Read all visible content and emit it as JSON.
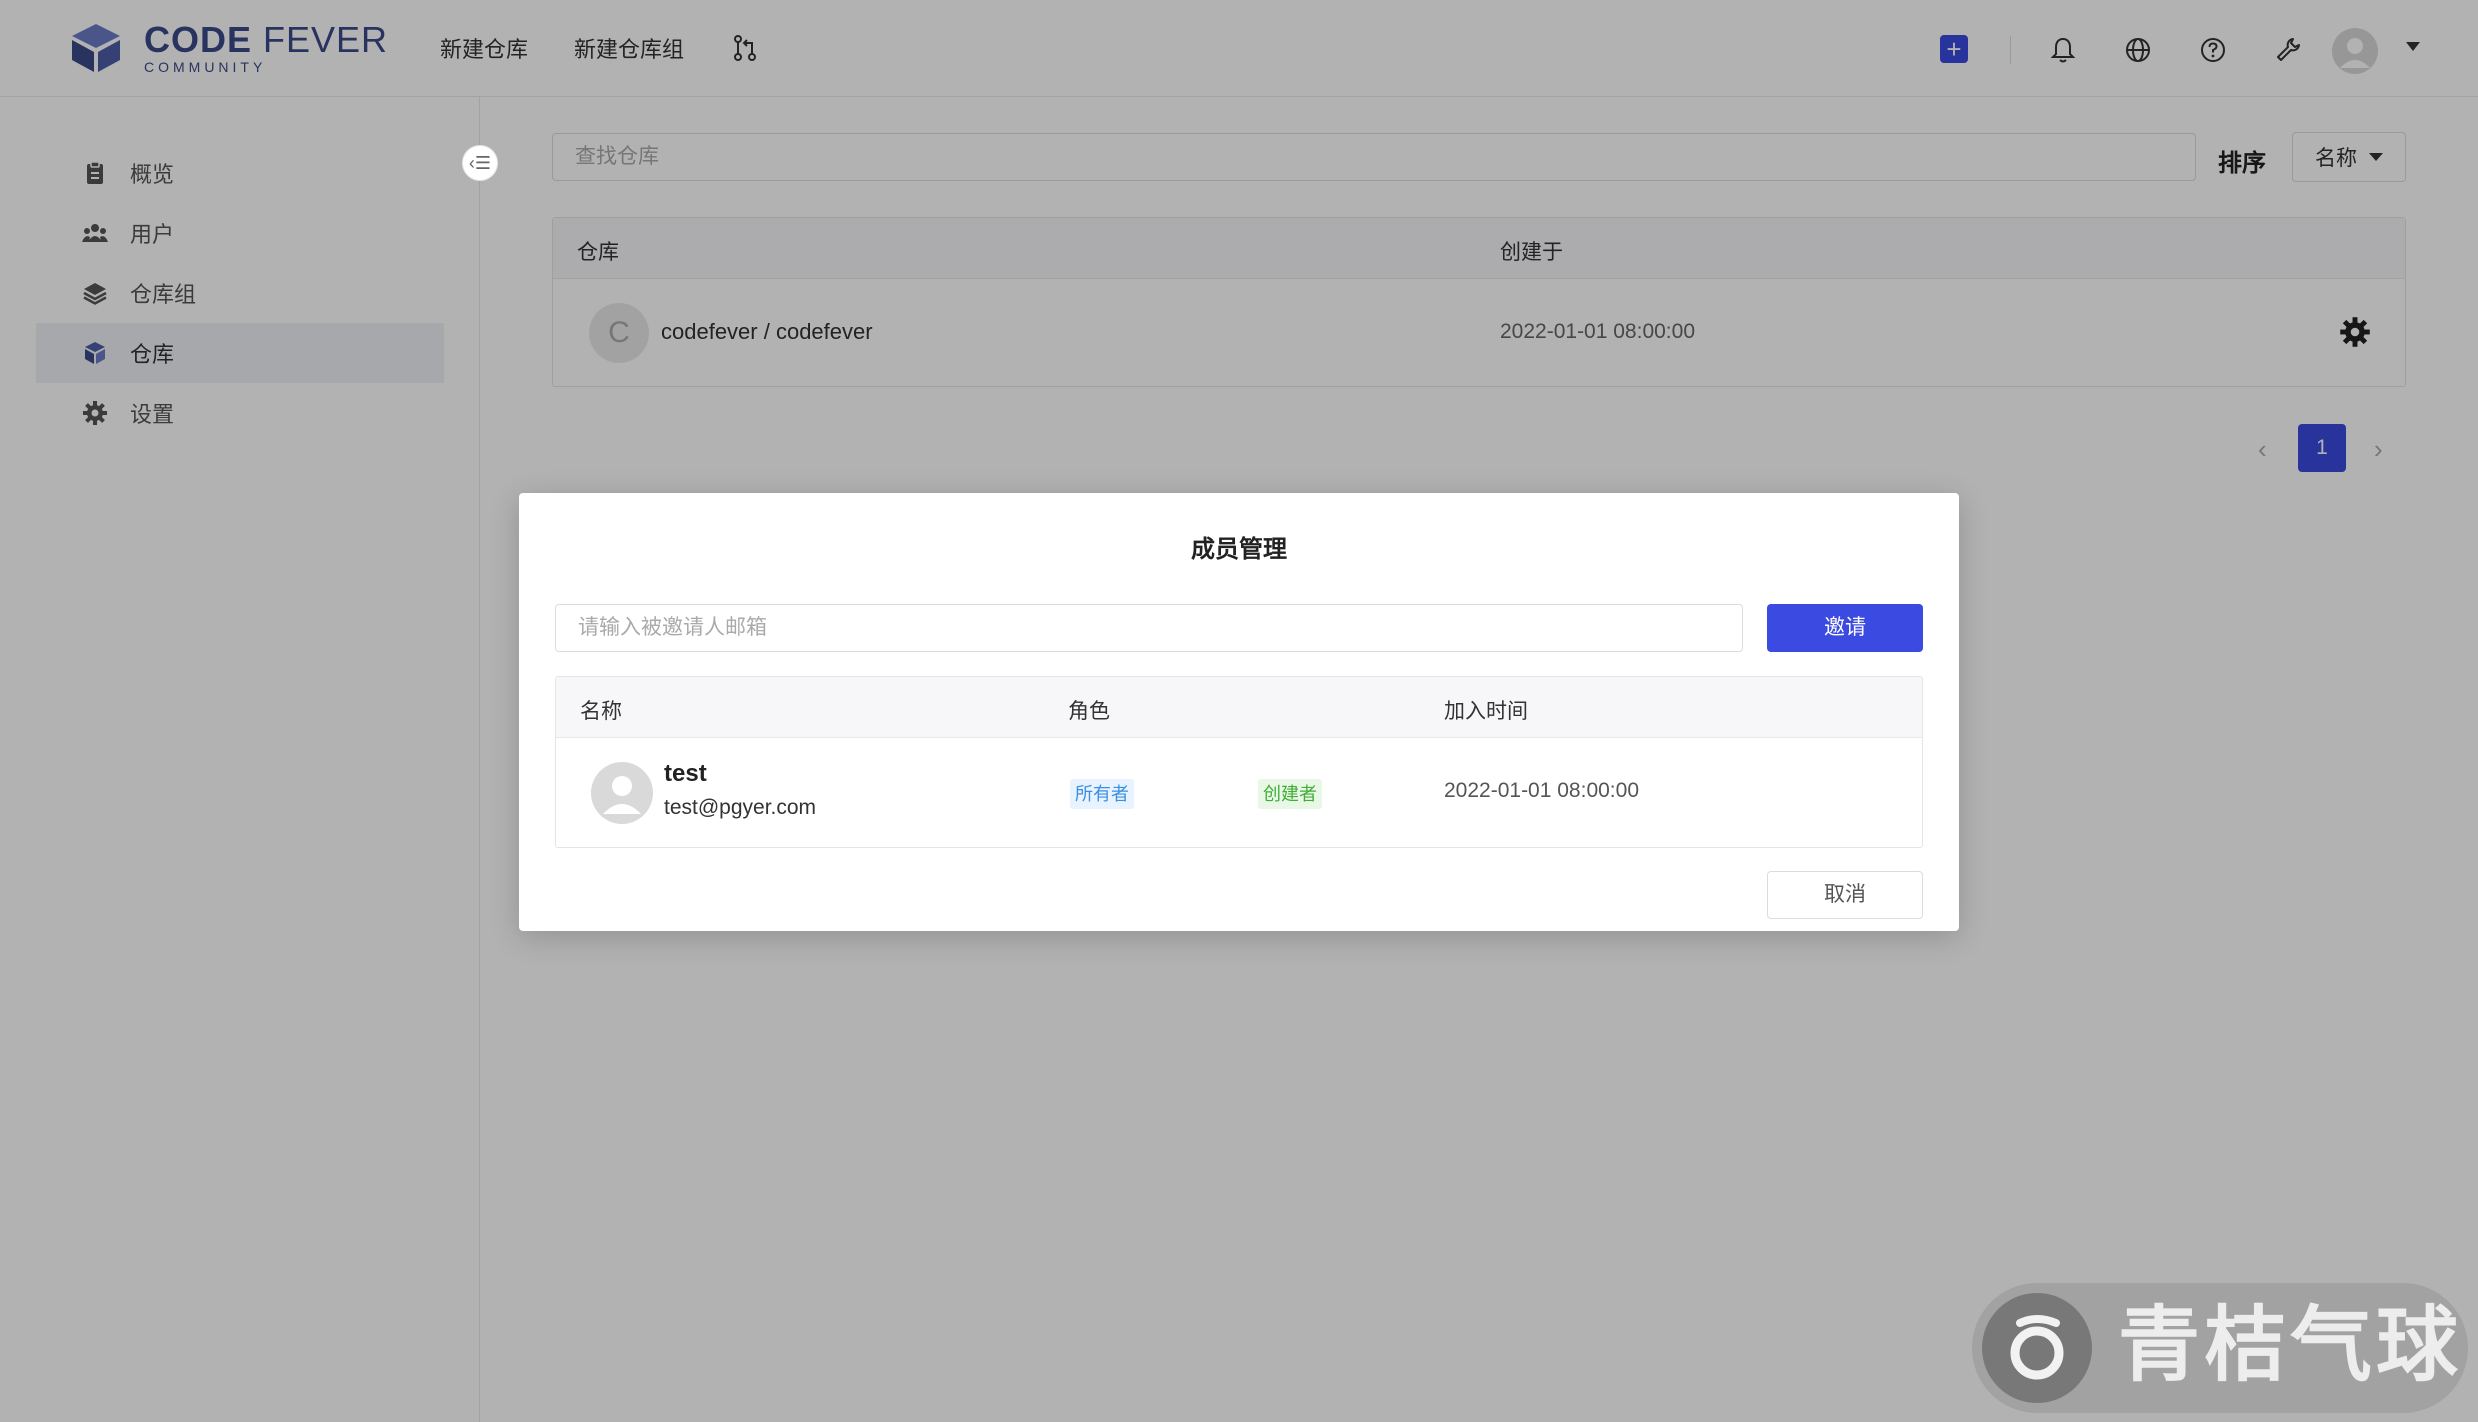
{
  "app": {
    "logo_main_bold": "CODE",
    "logo_main_rest": "FEVER",
    "logo_sub": "COMMUNITY"
  },
  "header": {
    "nav": [
      "新建仓库",
      "新建仓库组"
    ],
    "icons": [
      "merge-request-icon",
      "plus-icon",
      "bell-icon",
      "globe-icon",
      "help-icon",
      "tools-icon",
      "avatar",
      "caret-down-icon"
    ],
    "accent": "#3b4ae0"
  },
  "sidebar": {
    "items": [
      {
        "label": "概览",
        "icon": "clipboard-icon"
      },
      {
        "label": "用户",
        "icon": "users-icon"
      },
      {
        "label": "仓库组",
        "icon": "layers-icon"
      },
      {
        "label": "仓库",
        "icon": "cube-icon",
        "active": true
      },
      {
        "label": "设置",
        "icon": "gear-icon"
      }
    ],
    "collapse_icon": "‹☰"
  },
  "main": {
    "search_placeholder": "查找仓库",
    "sort_label": "排序",
    "sort_value": "名称",
    "table": {
      "headers": [
        "仓库",
        "创建于"
      ],
      "rows": [
        {
          "avatar_letter": "C",
          "name": "codefever / codefever",
          "created": "2022-01-01 08:00:00"
        }
      ]
    },
    "pagination": {
      "prev": "‹",
      "current": "1",
      "next": "›"
    }
  },
  "modal": {
    "title": "成员管理",
    "invite_placeholder": "请输入被邀请人邮箱",
    "invite_button": "邀请",
    "headers": [
      "名称",
      "角色",
      "加入时间"
    ],
    "members": [
      {
        "username": "test",
        "email": "test@pgyer.com",
        "roles": [
          "所有者",
          "创建者"
        ],
        "joined": "2022-01-01 08:00:00"
      }
    ],
    "cancel_button": "取消"
  },
  "watermark": {
    "text": "青桔气球"
  }
}
